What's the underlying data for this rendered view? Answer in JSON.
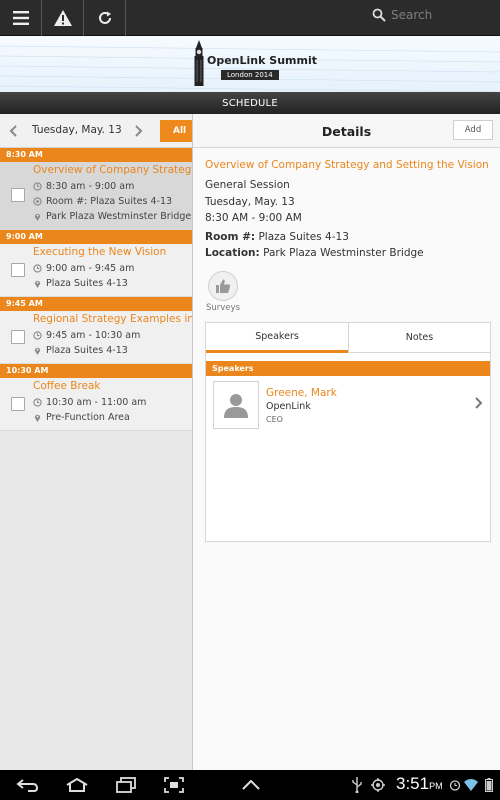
{
  "actionbar": {
    "search_placeholder": "Search"
  },
  "banner": {
    "title": "OpenLink Summit",
    "subtitle": "London 2014"
  },
  "schedule_bar": {
    "label": "SCHEDULE"
  },
  "left_pane": {
    "date": "Tuesday, May. 13",
    "all_label": "All",
    "sessions": [
      {
        "time_header": "8:30 AM",
        "title": "Overview of Company Strategy and Setting the Vision",
        "time": "8:30 am - 9:00 am",
        "room": "Room #: Plaza Suites 4-13",
        "location": "Park Plaza Westminster Bridge"
      },
      {
        "time_header": "9:00 AM",
        "title": "Executing the New Vision",
        "time": "9:00 am - 9:45 am",
        "location": "Plaza Suites 4-13"
      },
      {
        "time_header": "9:45 AM",
        "title": "Regional Strategy Examples in the",
        "time": "9:45 am - 10:30 am",
        "location": "Plaza Suites 4-13"
      },
      {
        "time_header": "10:30 AM",
        "title": "Coffee Break",
        "time": "10:30 am - 11:00 am",
        "location": "Pre-Function Area"
      }
    ]
  },
  "details": {
    "header": "Details",
    "add_label": "Add",
    "title": "Overview of Company Strategy and Setting the Vision",
    "type": "General Session",
    "date": "Tuesday, May. 13",
    "time": "8:30 AM - 9:00 AM",
    "room_label": "Room #:",
    "room_value": "Plaza Suites 4-13",
    "location_label": "Location:",
    "location_value": "Park Plaza Westminster Bridge",
    "surveys_label": "Surveys",
    "tabs": [
      "Speakers",
      "Notes"
    ],
    "speakers_header": "Speakers",
    "speaker": {
      "name": "Greene, Mark",
      "org": "OpenLink",
      "role": "CEO"
    }
  },
  "status": {
    "time": "3:51",
    "ampm": "PM"
  },
  "colors": {
    "accent": "#ea861b",
    "actionbar": "#2b2b2b"
  }
}
